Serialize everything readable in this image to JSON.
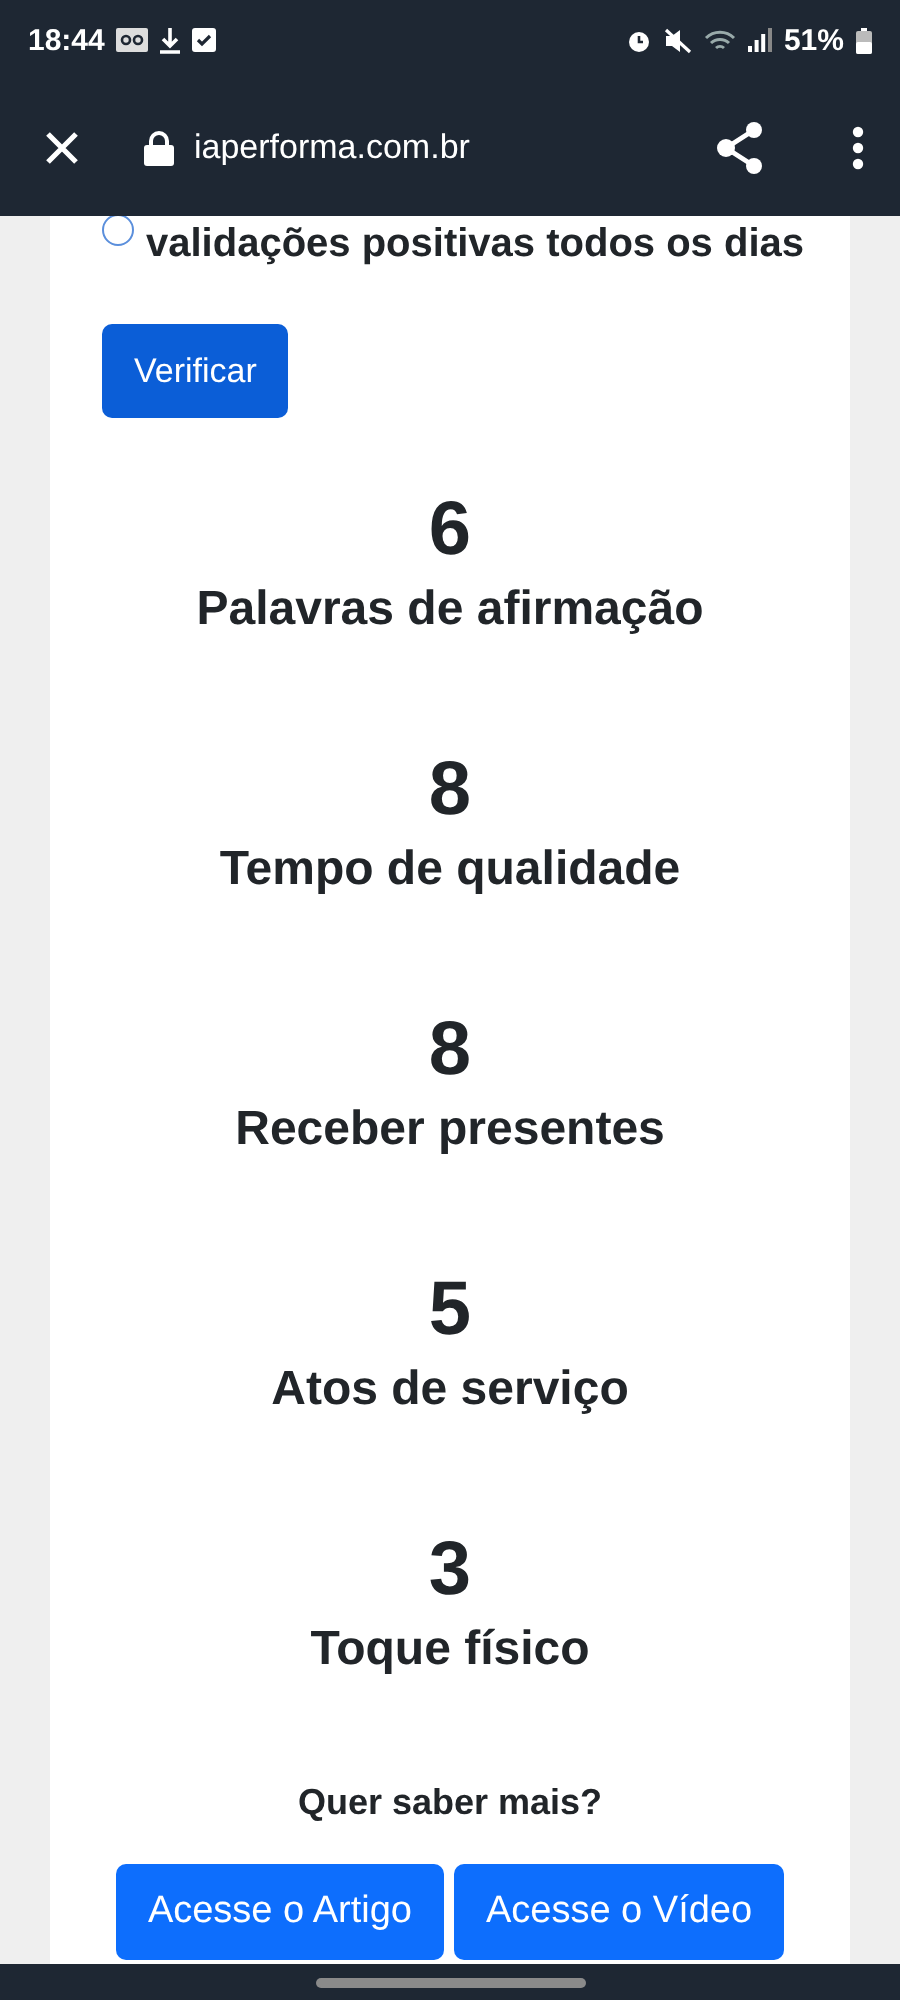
{
  "status_bar": {
    "time": "18:44",
    "battery": "51%"
  },
  "browser_bar": {
    "url": "iaperforma.com.br"
  },
  "question": {
    "text": "validações positivas todos os dias",
    "selected": false
  },
  "verify_button": "Verificar",
  "results": [
    {
      "score": "6",
      "label": "Palavras de afirmação"
    },
    {
      "score": "8",
      "label": "Tempo de qualidade"
    },
    {
      "score": "8",
      "label": "Receber presentes"
    },
    {
      "score": "5",
      "label": "Atos de serviço"
    },
    {
      "score": "3",
      "label": "Toque físico"
    }
  ],
  "more": {
    "title": "Quer saber mais?",
    "buttons": [
      "Acesse o Artigo",
      "Acesse o Vídeo"
    ]
  }
}
